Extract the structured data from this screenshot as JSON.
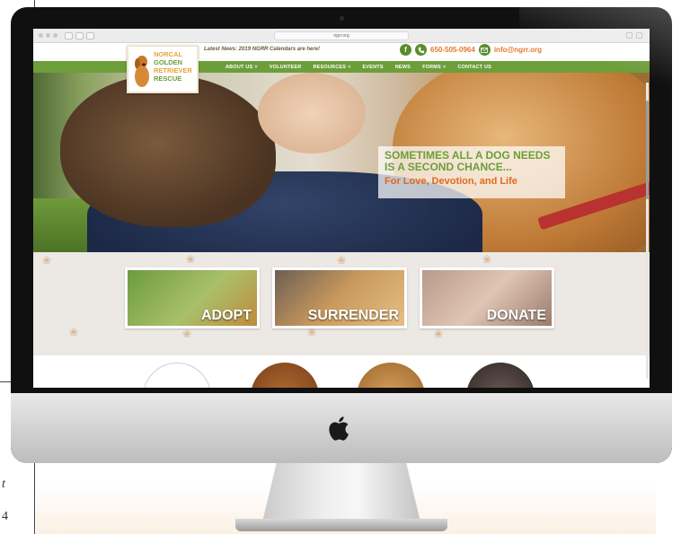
{
  "browser": {
    "url": "ngrr.org"
  },
  "header": {
    "latest_news": "Latest News: 2019 NGRR Calendars are here!",
    "facebook_icon": "f",
    "phone": "650-505-0964",
    "email": "info@ngrr.org"
  },
  "logo": {
    "lines": [
      "NORCAL",
      "GOLDEN",
      "RETRIEVER",
      "RESCUE"
    ]
  },
  "nav": {
    "items": [
      "ABOUT US",
      "VOLUNTEER",
      "RESOURCES",
      "EVENTS",
      "NEWS",
      "FORMS",
      "CONTACT US"
    ],
    "dropdown_items": [
      "ABOUT US",
      "RESOURCES",
      "FORMS"
    ]
  },
  "hero": {
    "line1": "SOMETIMES ALL A DOG NEEDS",
    "line2": "IS A SECOND CHANCE...",
    "line3": "For Love, Devotion, and Life"
  },
  "cta": {
    "adopt": "ADOPT",
    "surrender": "SURRENDER",
    "donate": "DONATE"
  },
  "page_fragments": {
    "left_t": "t",
    "left_4": "4"
  },
  "colors": {
    "brand_green": "#6c9e3a",
    "brand_orange": "#e8772a",
    "logo_gold": "#e8a33d"
  },
  "icons": {
    "facebook": "facebook-icon",
    "phone": "phone-icon",
    "email": "email-icon",
    "apple": "apple-logo-icon",
    "paw": "paw-print-icon"
  }
}
